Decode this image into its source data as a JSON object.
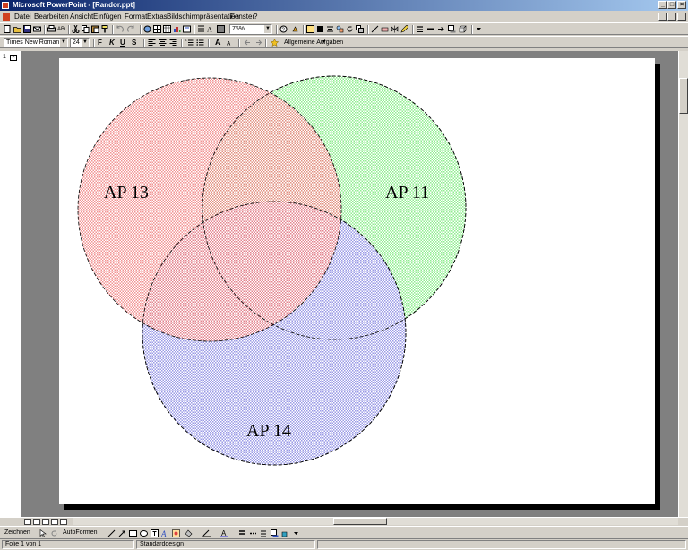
{
  "window": {
    "title": "Microsoft PowerPoint - [Randor.ppt]",
    "minimize": "_",
    "maximize": "□",
    "close": "×"
  },
  "menu": {
    "items": [
      "Datei",
      "Bearbeiten",
      "Ansicht",
      "Einfügen",
      "Format",
      "Extras",
      "Bildschirmpräsentation",
      "Fenster",
      "?"
    ]
  },
  "standard_toolbar": {
    "zoom_value": "75%"
  },
  "formatting_toolbar": {
    "font_name": "Times New Roman",
    "font_size": "24",
    "bold": "F",
    "italic": "K",
    "underline": "U",
    "shadow": "S",
    "grow_font": "A",
    "common_tasks_label": "Allgemeine Aufgaben"
  },
  "outline": {
    "slide_number": "1"
  },
  "slide": {
    "colors": {
      "circle_red": "#f08080",
      "circle_green": "#90ee90",
      "circle_blue": "#9a9ae6"
    },
    "labels": {
      "ap13": "AP 13",
      "ap11": "AP 11",
      "ap14": "AP 14"
    }
  },
  "drawing_toolbar": {
    "draw_label": "Zeichnen",
    "autoshapes_label": "AutoFormen"
  },
  "status": {
    "slide_info": "Folie 1 von 1",
    "design_name": "Standarddesign"
  }
}
